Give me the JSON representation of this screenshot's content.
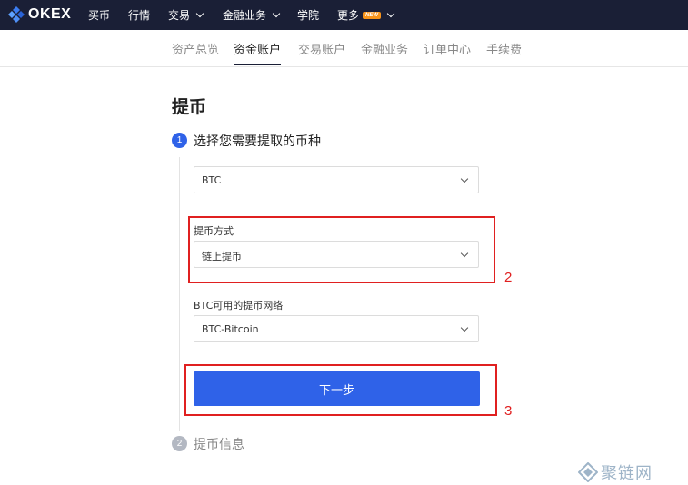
{
  "brand": {
    "name": "OKEX",
    "accent": "#2f62e8",
    "nav_bg": "#1a1f36"
  },
  "topnav": {
    "items": [
      {
        "label": "买币"
      },
      {
        "label": "行情"
      },
      {
        "label": "交易"
      },
      {
        "label": "金融业务"
      },
      {
        "label": "学院"
      },
      {
        "label": "更多",
        "badge": "NEW"
      }
    ]
  },
  "subnav": {
    "tabs": [
      {
        "label": "资产总览"
      },
      {
        "label": "资金账户",
        "active": true
      },
      {
        "label": "交易账户"
      },
      {
        "label": "金融业务"
      },
      {
        "label": "订单中心"
      },
      {
        "label": "手续费"
      }
    ]
  },
  "page": {
    "title": "提币"
  },
  "step1": {
    "number": "1",
    "label": "选择您需要提取的币种",
    "color": "#2f62e8",
    "coin_select": {
      "value": "BTC"
    },
    "method": {
      "label": "提币方式",
      "value": "链上提币"
    },
    "network": {
      "label": "BTC可用的提币网络",
      "value": "BTC-Bitcoin"
    },
    "next_button": "下一步"
  },
  "step2": {
    "number": "2",
    "label": "提币信息",
    "color": "#b3b8c2"
  },
  "annotations": [
    {
      "label": "2",
      "color": "#e02020"
    },
    {
      "label": "3",
      "color": "#e02020"
    }
  ],
  "watermark": {
    "text": "聚链网"
  }
}
